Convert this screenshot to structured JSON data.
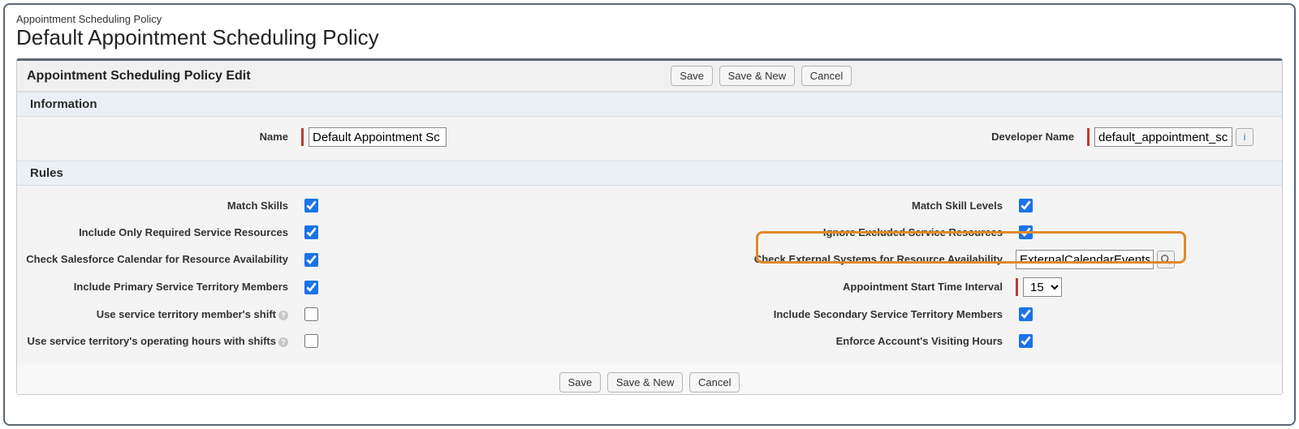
{
  "header": {
    "object_type": "Appointment Scheduling Policy",
    "title": "Default Appointment Scheduling Policy",
    "panel_title": "Appointment Scheduling Policy Edit"
  },
  "buttons": {
    "save": "Save",
    "save_and_new": "Save & New",
    "cancel": "Cancel"
  },
  "sections": {
    "information": "Information",
    "rules": "Rules"
  },
  "info": {
    "name_label": "Name",
    "name_value": "Default Appointment Sc",
    "dev_name_label": "Developer Name",
    "dev_name_value": "default_appointment_sc"
  },
  "rules": {
    "match_skills": {
      "label": "Match Skills",
      "checked": true
    },
    "match_skill_levels": {
      "label": "Match Skill Levels",
      "checked": true
    },
    "include_only_required": {
      "label": "Include Only Required Service Resources",
      "checked": true
    },
    "ignore_excluded": {
      "label": "Ignore Excluded Service Resources",
      "checked": true
    },
    "check_sf_calendar": {
      "label": "Check Salesforce Calendar for Resource Availability",
      "checked": true
    },
    "check_external": {
      "label": "Check External Systems for Resource Availability",
      "value": "ExternalCalendarEvents"
    },
    "include_primary_territory": {
      "label": "Include Primary Service Territory Members",
      "checked": true
    },
    "appt_start_interval": {
      "label": "Appointment Start Time Interval",
      "value": "15"
    },
    "use_territory_shift": {
      "label": "Use service territory member's shift",
      "checked": false
    },
    "include_secondary_territory": {
      "label": "Include Secondary Service Territory Members",
      "checked": true
    },
    "use_operating_hours": {
      "label": "Use service territory's operating hours with shifts",
      "checked": false
    },
    "enforce_visiting_hours": {
      "label": "Enforce Account's Visiting Hours",
      "checked": true
    }
  }
}
